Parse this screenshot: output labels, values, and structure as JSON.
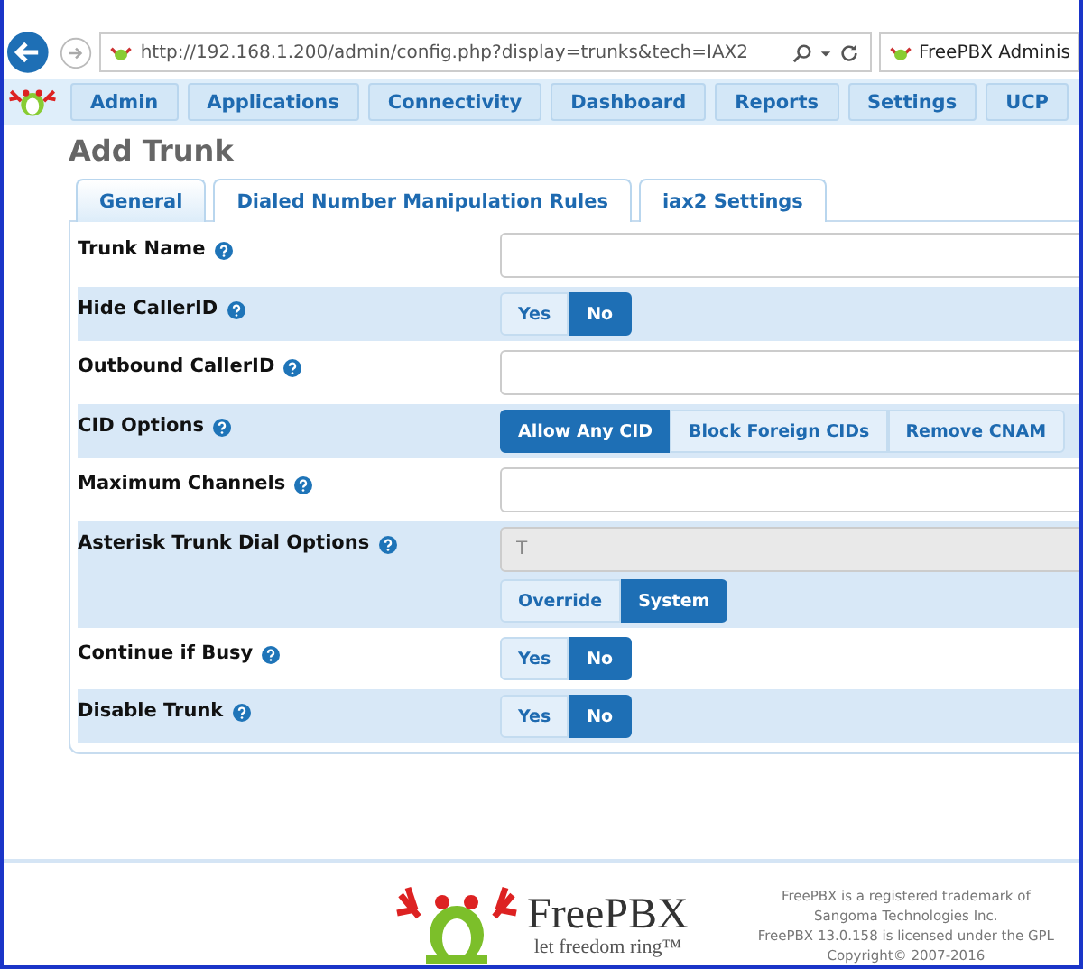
{
  "browser": {
    "url": "http://192.168.1.200/admin/config.php?display=trunks&tech=IAX2",
    "tab_title": "FreePBX Adminis"
  },
  "nav": [
    "Admin",
    "Applications",
    "Connectivity",
    "Dashboard",
    "Reports",
    "Settings",
    "UCP"
  ],
  "page_title": "Add Trunk",
  "tabs": [
    {
      "label": "General",
      "selected": true
    },
    {
      "label": "Dialed Number Manipulation Rules",
      "selected": false
    },
    {
      "label": "iax2 Settings",
      "selected": false
    }
  ],
  "rows": [
    {
      "kind": "text",
      "label": "Trunk Name"
    },
    {
      "kind": "toggle",
      "label": "Hide CallerID",
      "options": [
        {
          "label": "Yes",
          "selected": false
        },
        {
          "label": "No",
          "selected": true
        }
      ]
    },
    {
      "kind": "text",
      "label": "Outbound CallerID"
    },
    {
      "kind": "toggle",
      "label": "CID Options",
      "options": [
        {
          "label": "Allow Any CID",
          "selected": true
        },
        {
          "label": "Block Foreign CIDs",
          "selected": false
        },
        {
          "label": "Remove CNAM",
          "selected": false
        }
      ]
    },
    {
      "kind": "text",
      "label": "Maximum Channels"
    },
    {
      "kind": "override",
      "label": "Asterisk Trunk Dial Options",
      "value": "T",
      "options": [
        {
          "label": "Override",
          "selected": false
        },
        {
          "label": "System",
          "selected": true
        }
      ]
    },
    {
      "kind": "toggle",
      "label": "Continue if Busy",
      "options": [
        {
          "label": "Yes",
          "selected": false
        },
        {
          "label": "No",
          "selected": true
        }
      ]
    },
    {
      "kind": "toggle",
      "label": "Disable Trunk",
      "options": [
        {
          "label": "Yes",
          "selected": false
        },
        {
          "label": "No",
          "selected": true
        }
      ]
    }
  ],
  "footer": {
    "brand": "FreePBX",
    "tagline": "let freedom ring™",
    "legal": [
      "FreePBX is a registered trademark of",
      "Sangoma Technologies Inc.",
      "FreePBX 13.0.158 is licensed under the GPL",
      "Copyright© 2007-2016"
    ]
  }
}
